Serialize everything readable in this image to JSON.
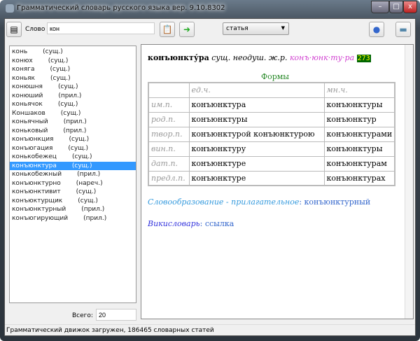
{
  "window": {
    "title": "Грамматический словарь русского языка вер. 9.10.8302"
  },
  "toolbar": {
    "word_label": "Слово",
    "word_value": "кон",
    "mode_select": "статья"
  },
  "list": [
    {
      "w": "конь",
      "p": "(сущ.)"
    },
    {
      "w": "конюх",
      "p": "(сущ.)"
    },
    {
      "w": "коняга",
      "p": "(сущ.)"
    },
    {
      "w": "коньяк",
      "p": "(сущ.)"
    },
    {
      "w": "конюшня",
      "p": "(сущ.)"
    },
    {
      "w": "конюший",
      "p": "(прил.)"
    },
    {
      "w": "коньячок",
      "p": "(сущ.)"
    },
    {
      "w": "Коншаков",
      "p": "(сущ.)"
    },
    {
      "w": "коньячный",
      "p": "(прил.)"
    },
    {
      "w": "коньковый",
      "p": "(прил.)"
    },
    {
      "w": "конъюнкция",
      "p": "(сущ.)"
    },
    {
      "w": "конъюгация",
      "p": "(сущ.)"
    },
    {
      "w": "конькобежец",
      "p": "(сущ.)"
    },
    {
      "w": "конъюнктура",
      "p": "(сущ.)"
    },
    {
      "w": "конькобежный",
      "p": "(прил.)"
    },
    {
      "w": "конъюнктурно",
      "p": "(нареч.)"
    },
    {
      "w": "конъюнктивит",
      "p": "(сущ.)"
    },
    {
      "w": "конъюктурщик",
      "p": "(сущ.)"
    },
    {
      "w": "конъюнктурный",
      "p": "(прил.)"
    },
    {
      "w": "конъюгирующий",
      "p": "(прил.)"
    }
  ],
  "selected_index": 13,
  "total": {
    "label": "Всего:",
    "value": "20"
  },
  "article": {
    "headword": "конъюнкту́ра",
    "grammar": "сущ. неодуш. ж.р.",
    "syllables": "конъ·юнк·ту·ра",
    "badge": "273",
    "forms_title": "Формы",
    "header": [
      "",
      "ед.ч.",
      "мн.ч."
    ],
    "rows": [
      [
        "им.п.",
        "конъюнктура",
        "конъюнктуры"
      ],
      [
        "род.п.",
        "конъюнктуры",
        "конъюнктур"
      ],
      [
        "твор.п.",
        "конъюнктурой  конъюнктурою",
        "конъюнктурами"
      ],
      [
        "вин.п.",
        "конъюнктуру",
        "конъюнктуры"
      ],
      [
        "дат.п.",
        "конъюнктуре",
        "конъюнктурам"
      ],
      [
        "предл.п.",
        "конъюнктуре",
        "конъюнктурах"
      ]
    ],
    "derivation_label": "Словообразование - прилагательное",
    "derivation_value": "конъюнктурный",
    "wiki_label": "Викисловарь",
    "wiki_link": "ссылка"
  },
  "status": "Грамматический движок загружен, 186465 словарных статей",
  "colors": {
    "selection": "#3399ff",
    "forms": "#2a8a2a",
    "syllables": "#d040d0",
    "badge_bg": "#006600",
    "badge_fg": "#ffff00",
    "derivation": "#3399dd",
    "wiki": "#3333dd"
  }
}
